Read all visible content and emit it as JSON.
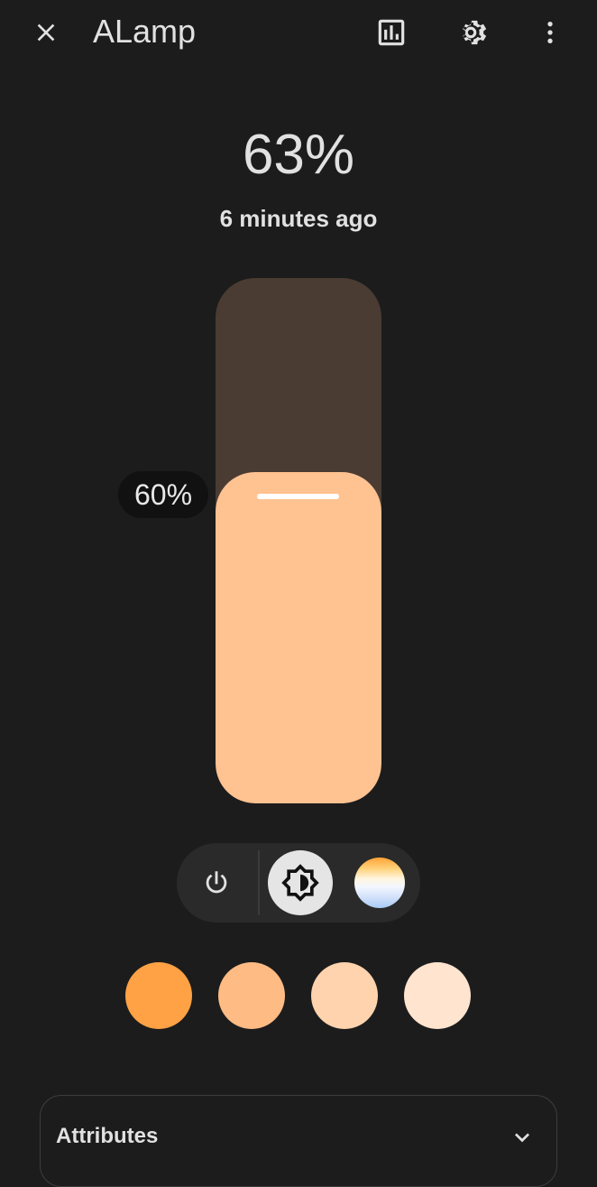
{
  "header": {
    "title": "ALamp",
    "close_icon": "close-icon",
    "history_icon": "chart-box-icon",
    "settings_icon": "gear-icon",
    "menu_icon": "dots-vertical-icon"
  },
  "entity": {
    "state": "63%",
    "last_changed": "6 minutes ago"
  },
  "brightness_slider": {
    "tooltip": "60%",
    "value_percent": 63,
    "fill_color": "#ffc291",
    "track_color": "#4a3c33"
  },
  "modes": {
    "power_icon": "power-icon",
    "brightness_icon": "brightness-contrast-icon",
    "color_temp_icon": "color-temperature-swatch",
    "selected": "brightness"
  },
  "favorite_colors": [
    "#ffa245",
    "#ffbb84",
    "#ffd3ad",
    "#ffe4cf"
  ],
  "attributes": {
    "label": "Attributes",
    "chevron_icon": "chevron-down-icon"
  }
}
